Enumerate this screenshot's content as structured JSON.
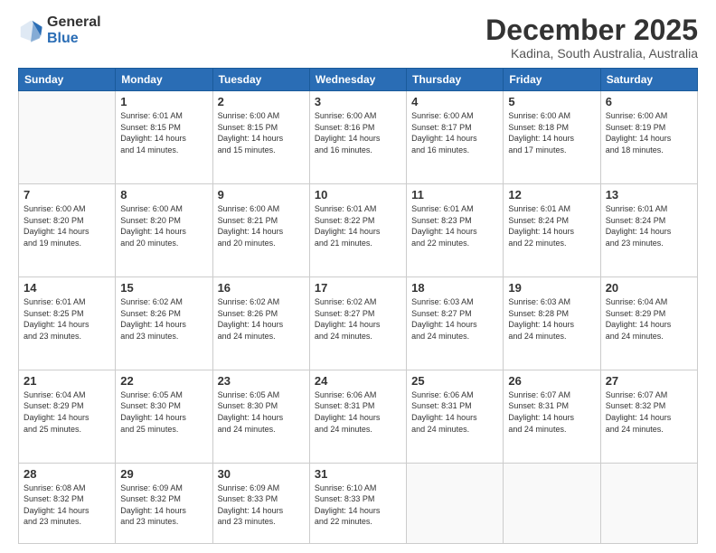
{
  "logo": {
    "general": "General",
    "blue": "Blue"
  },
  "title": "December 2025",
  "location": "Kadina, South Australia, Australia",
  "weekdays": [
    "Sunday",
    "Monday",
    "Tuesday",
    "Wednesday",
    "Thursday",
    "Friday",
    "Saturday"
  ],
  "weeks": [
    [
      {
        "day": "",
        "info": ""
      },
      {
        "day": "1",
        "info": "Sunrise: 6:01 AM\nSunset: 8:15 PM\nDaylight: 14 hours\nand 14 minutes."
      },
      {
        "day": "2",
        "info": "Sunrise: 6:00 AM\nSunset: 8:15 PM\nDaylight: 14 hours\nand 15 minutes."
      },
      {
        "day": "3",
        "info": "Sunrise: 6:00 AM\nSunset: 8:16 PM\nDaylight: 14 hours\nand 16 minutes."
      },
      {
        "day": "4",
        "info": "Sunrise: 6:00 AM\nSunset: 8:17 PM\nDaylight: 14 hours\nand 16 minutes."
      },
      {
        "day": "5",
        "info": "Sunrise: 6:00 AM\nSunset: 8:18 PM\nDaylight: 14 hours\nand 17 minutes."
      },
      {
        "day": "6",
        "info": "Sunrise: 6:00 AM\nSunset: 8:19 PM\nDaylight: 14 hours\nand 18 minutes."
      }
    ],
    [
      {
        "day": "7",
        "info": "Sunrise: 6:00 AM\nSunset: 8:20 PM\nDaylight: 14 hours\nand 19 minutes."
      },
      {
        "day": "8",
        "info": "Sunrise: 6:00 AM\nSunset: 8:20 PM\nDaylight: 14 hours\nand 20 minutes."
      },
      {
        "day": "9",
        "info": "Sunrise: 6:00 AM\nSunset: 8:21 PM\nDaylight: 14 hours\nand 20 minutes."
      },
      {
        "day": "10",
        "info": "Sunrise: 6:01 AM\nSunset: 8:22 PM\nDaylight: 14 hours\nand 21 minutes."
      },
      {
        "day": "11",
        "info": "Sunrise: 6:01 AM\nSunset: 8:23 PM\nDaylight: 14 hours\nand 22 minutes."
      },
      {
        "day": "12",
        "info": "Sunrise: 6:01 AM\nSunset: 8:24 PM\nDaylight: 14 hours\nand 22 minutes."
      },
      {
        "day": "13",
        "info": "Sunrise: 6:01 AM\nSunset: 8:24 PM\nDaylight: 14 hours\nand 23 minutes."
      }
    ],
    [
      {
        "day": "14",
        "info": "Sunrise: 6:01 AM\nSunset: 8:25 PM\nDaylight: 14 hours\nand 23 minutes."
      },
      {
        "day": "15",
        "info": "Sunrise: 6:02 AM\nSunset: 8:26 PM\nDaylight: 14 hours\nand 23 minutes."
      },
      {
        "day": "16",
        "info": "Sunrise: 6:02 AM\nSunset: 8:26 PM\nDaylight: 14 hours\nand 24 minutes."
      },
      {
        "day": "17",
        "info": "Sunrise: 6:02 AM\nSunset: 8:27 PM\nDaylight: 14 hours\nand 24 minutes."
      },
      {
        "day": "18",
        "info": "Sunrise: 6:03 AM\nSunset: 8:27 PM\nDaylight: 14 hours\nand 24 minutes."
      },
      {
        "day": "19",
        "info": "Sunrise: 6:03 AM\nSunset: 8:28 PM\nDaylight: 14 hours\nand 24 minutes."
      },
      {
        "day": "20",
        "info": "Sunrise: 6:04 AM\nSunset: 8:29 PM\nDaylight: 14 hours\nand 24 minutes."
      }
    ],
    [
      {
        "day": "21",
        "info": "Sunrise: 6:04 AM\nSunset: 8:29 PM\nDaylight: 14 hours\nand 25 minutes."
      },
      {
        "day": "22",
        "info": "Sunrise: 6:05 AM\nSunset: 8:30 PM\nDaylight: 14 hours\nand 25 minutes."
      },
      {
        "day": "23",
        "info": "Sunrise: 6:05 AM\nSunset: 8:30 PM\nDaylight: 14 hours\nand 24 minutes."
      },
      {
        "day": "24",
        "info": "Sunrise: 6:06 AM\nSunset: 8:31 PM\nDaylight: 14 hours\nand 24 minutes."
      },
      {
        "day": "25",
        "info": "Sunrise: 6:06 AM\nSunset: 8:31 PM\nDaylight: 14 hours\nand 24 minutes."
      },
      {
        "day": "26",
        "info": "Sunrise: 6:07 AM\nSunset: 8:31 PM\nDaylight: 14 hours\nand 24 minutes."
      },
      {
        "day": "27",
        "info": "Sunrise: 6:07 AM\nSunset: 8:32 PM\nDaylight: 14 hours\nand 24 minutes."
      }
    ],
    [
      {
        "day": "28",
        "info": "Sunrise: 6:08 AM\nSunset: 8:32 PM\nDaylight: 14 hours\nand 23 minutes."
      },
      {
        "day": "29",
        "info": "Sunrise: 6:09 AM\nSunset: 8:32 PM\nDaylight: 14 hours\nand 23 minutes."
      },
      {
        "day": "30",
        "info": "Sunrise: 6:09 AM\nSunset: 8:33 PM\nDaylight: 14 hours\nand 23 minutes."
      },
      {
        "day": "31",
        "info": "Sunrise: 6:10 AM\nSunset: 8:33 PM\nDaylight: 14 hours\nand 22 minutes."
      },
      {
        "day": "",
        "info": ""
      },
      {
        "day": "",
        "info": ""
      },
      {
        "day": "",
        "info": ""
      }
    ]
  ]
}
